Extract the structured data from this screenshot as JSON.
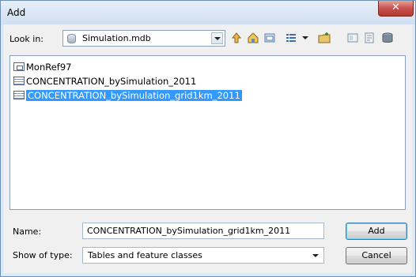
{
  "window": {
    "title": "Add",
    "close_glyph": "✕"
  },
  "toolbar": {
    "look_in_label": "Look in:",
    "location": "Simulation.mdb",
    "icons": [
      "up-one-level-icon",
      "home-icon",
      "connect-folder-icon",
      "list-view-icon",
      "view-options-dropdown-icon",
      "new-folder-icon",
      "catalog-icon",
      "details-icon",
      "database-icon"
    ]
  },
  "items": [
    {
      "label": "MonRef97",
      "icon": "feature-dataset-icon",
      "selected": false
    },
    {
      "label": "CONCENTRATION_bySimulation_2011",
      "icon": "table-icon",
      "selected": false
    },
    {
      "label": "CONCENTRATION_bySimulation_grid1km_2011",
      "icon": "table-icon",
      "selected": true
    }
  ],
  "form": {
    "name_label": "Name:",
    "name_value": "CONCENTRATION_bySimulation_grid1km_2011",
    "type_label": "Show of type:",
    "type_value": "Tables and feature classes"
  },
  "buttons": {
    "add": "Add",
    "cancel": "Cancel"
  },
  "colors": {
    "selection": "#3399ff",
    "close": "#c75050"
  }
}
